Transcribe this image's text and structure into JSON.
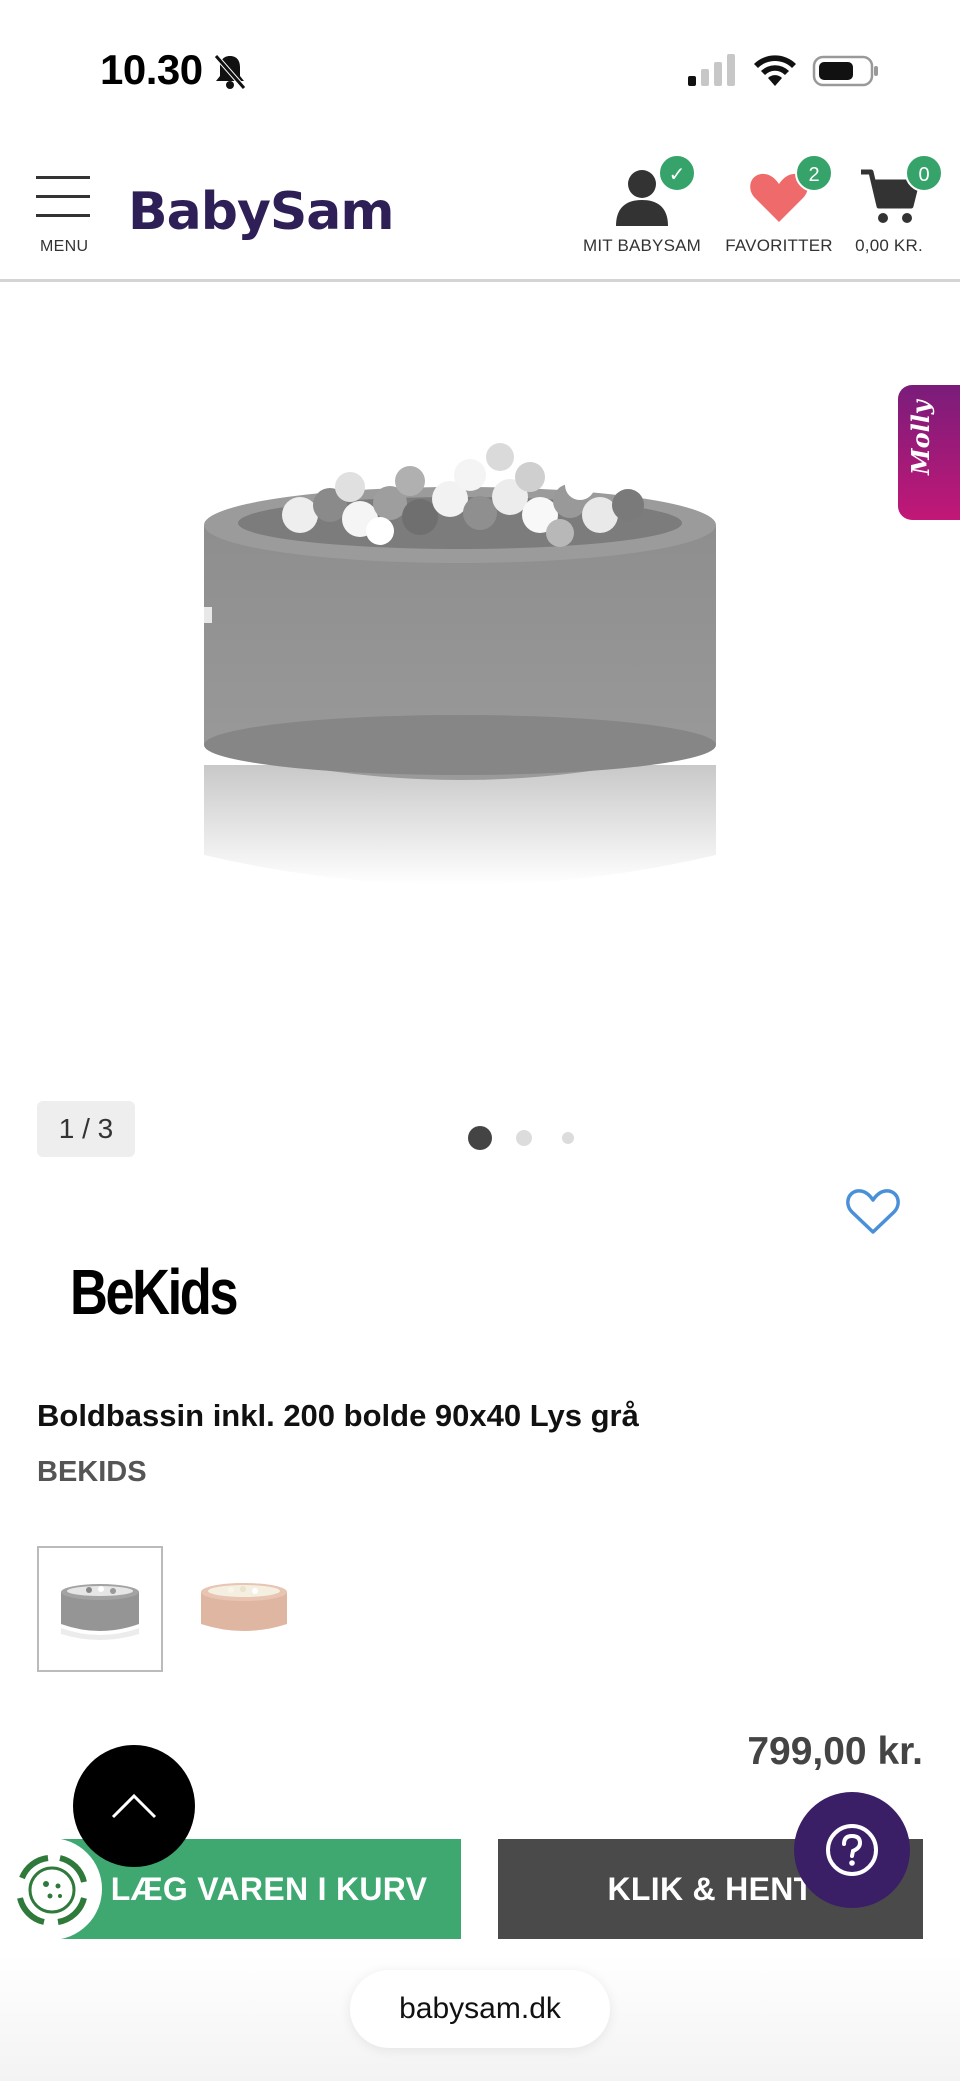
{
  "status_bar": {
    "time": "10.30",
    "icons": [
      "bell-slash-icon",
      "cellular-signal-icon",
      "wifi-icon",
      "battery-icon"
    ]
  },
  "header": {
    "menu_label": "MENU",
    "logo_text": "BabySam",
    "actions": [
      {
        "label": "MIT BABYSAM",
        "icon": "user-icon",
        "badge": "✓"
      },
      {
        "label": "FAVORITTER",
        "icon": "heart-icon",
        "badge": "2"
      },
      {
        "label": "0,00 KR.",
        "icon": "cart-icon",
        "badge": "0"
      }
    ]
  },
  "gallery": {
    "counter": "1 / 3",
    "dots_total": 3,
    "dots_active": 1,
    "side_tab": "Molly"
  },
  "product": {
    "brand_logo": "BeKids",
    "title": "Boldbassin inkl. 200 bolde 90x40 Lys grå",
    "brand": "BEKIDS",
    "variants": [
      "grey",
      "rose"
    ],
    "selected_variant": 0,
    "price": "799,00 kr."
  },
  "actions": {
    "add_to_cart": "LÆG VAREN I KURV",
    "click_collect": "KLIK & HENT"
  },
  "browser": {
    "url": "babysam.dk"
  },
  "colors": {
    "brand": "#2e1f57",
    "green": "#3ea870",
    "dark_button": "#4a4a4a",
    "heart": "#ef6b6b",
    "help": "#3a1f66",
    "molly_gradient": [
      "#7a1c7a",
      "#c21877"
    ],
    "favorite_outline": "#4a90d9"
  }
}
